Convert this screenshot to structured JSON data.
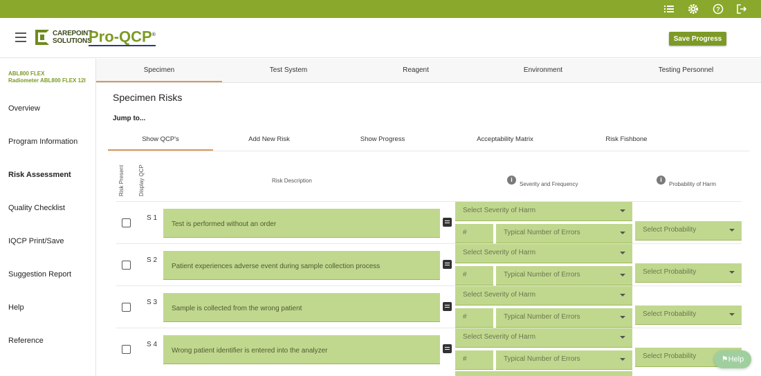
{
  "header": {
    "logo_line1": "CAREPOINT",
    "logo_line2": "SOLUTIONS",
    "brand": "Pro-QCP",
    "brand_tm": "®",
    "save_label": "Save Progress"
  },
  "sidebar": {
    "device_line1": "ABL800 FLEX",
    "device_line2": "Radiometer ABL800 FLEX 12I",
    "items": [
      {
        "label": "Overview"
      },
      {
        "label": "Program Information"
      },
      {
        "label": "Risk Assessment"
      },
      {
        "label": "Quality Checklist"
      },
      {
        "label": "IQCP Print/Save"
      },
      {
        "label": "Suggestion Report"
      },
      {
        "label": "Help"
      },
      {
        "label": "Reference"
      }
    ]
  },
  "tabs": [
    {
      "label": "Specimen"
    },
    {
      "label": "Test System"
    },
    {
      "label": "Reagent"
    },
    {
      "label": "Environment"
    },
    {
      "label": "Testing Personnel"
    }
  ],
  "main": {
    "title": "Specimen Risks",
    "jump": "Jump to...",
    "subtabs": [
      {
        "label": "Show QCP's"
      },
      {
        "label": "Add New Risk"
      },
      {
        "label": "Show Progress"
      },
      {
        "label": "Acceptability Matrix"
      },
      {
        "label": "Risk Fishbone"
      }
    ],
    "columns": {
      "risk_present": "Risk Present",
      "display_qcp": "Display QCP",
      "risk_description": "Risk Description",
      "severity": "Severity and Frequency",
      "probability": "Probability of Harm"
    },
    "placeholders": {
      "severity": "Select Severity of Harm",
      "count": "#",
      "errors": "Typical Number of Errors",
      "probability": "Select Probability"
    },
    "rows": [
      {
        "id": "S 1",
        "desc": "Test is performed without an order"
      },
      {
        "id": "S 2",
        "desc": "Patient experiences adverse event during sample collection process"
      },
      {
        "id": "S 3",
        "desc": "Sample is collected from the wrong patient"
      },
      {
        "id": "S 4",
        "desc": "Wrong patient identifier is entered into the analyzer"
      }
    ]
  },
  "help_fab": "Help"
}
